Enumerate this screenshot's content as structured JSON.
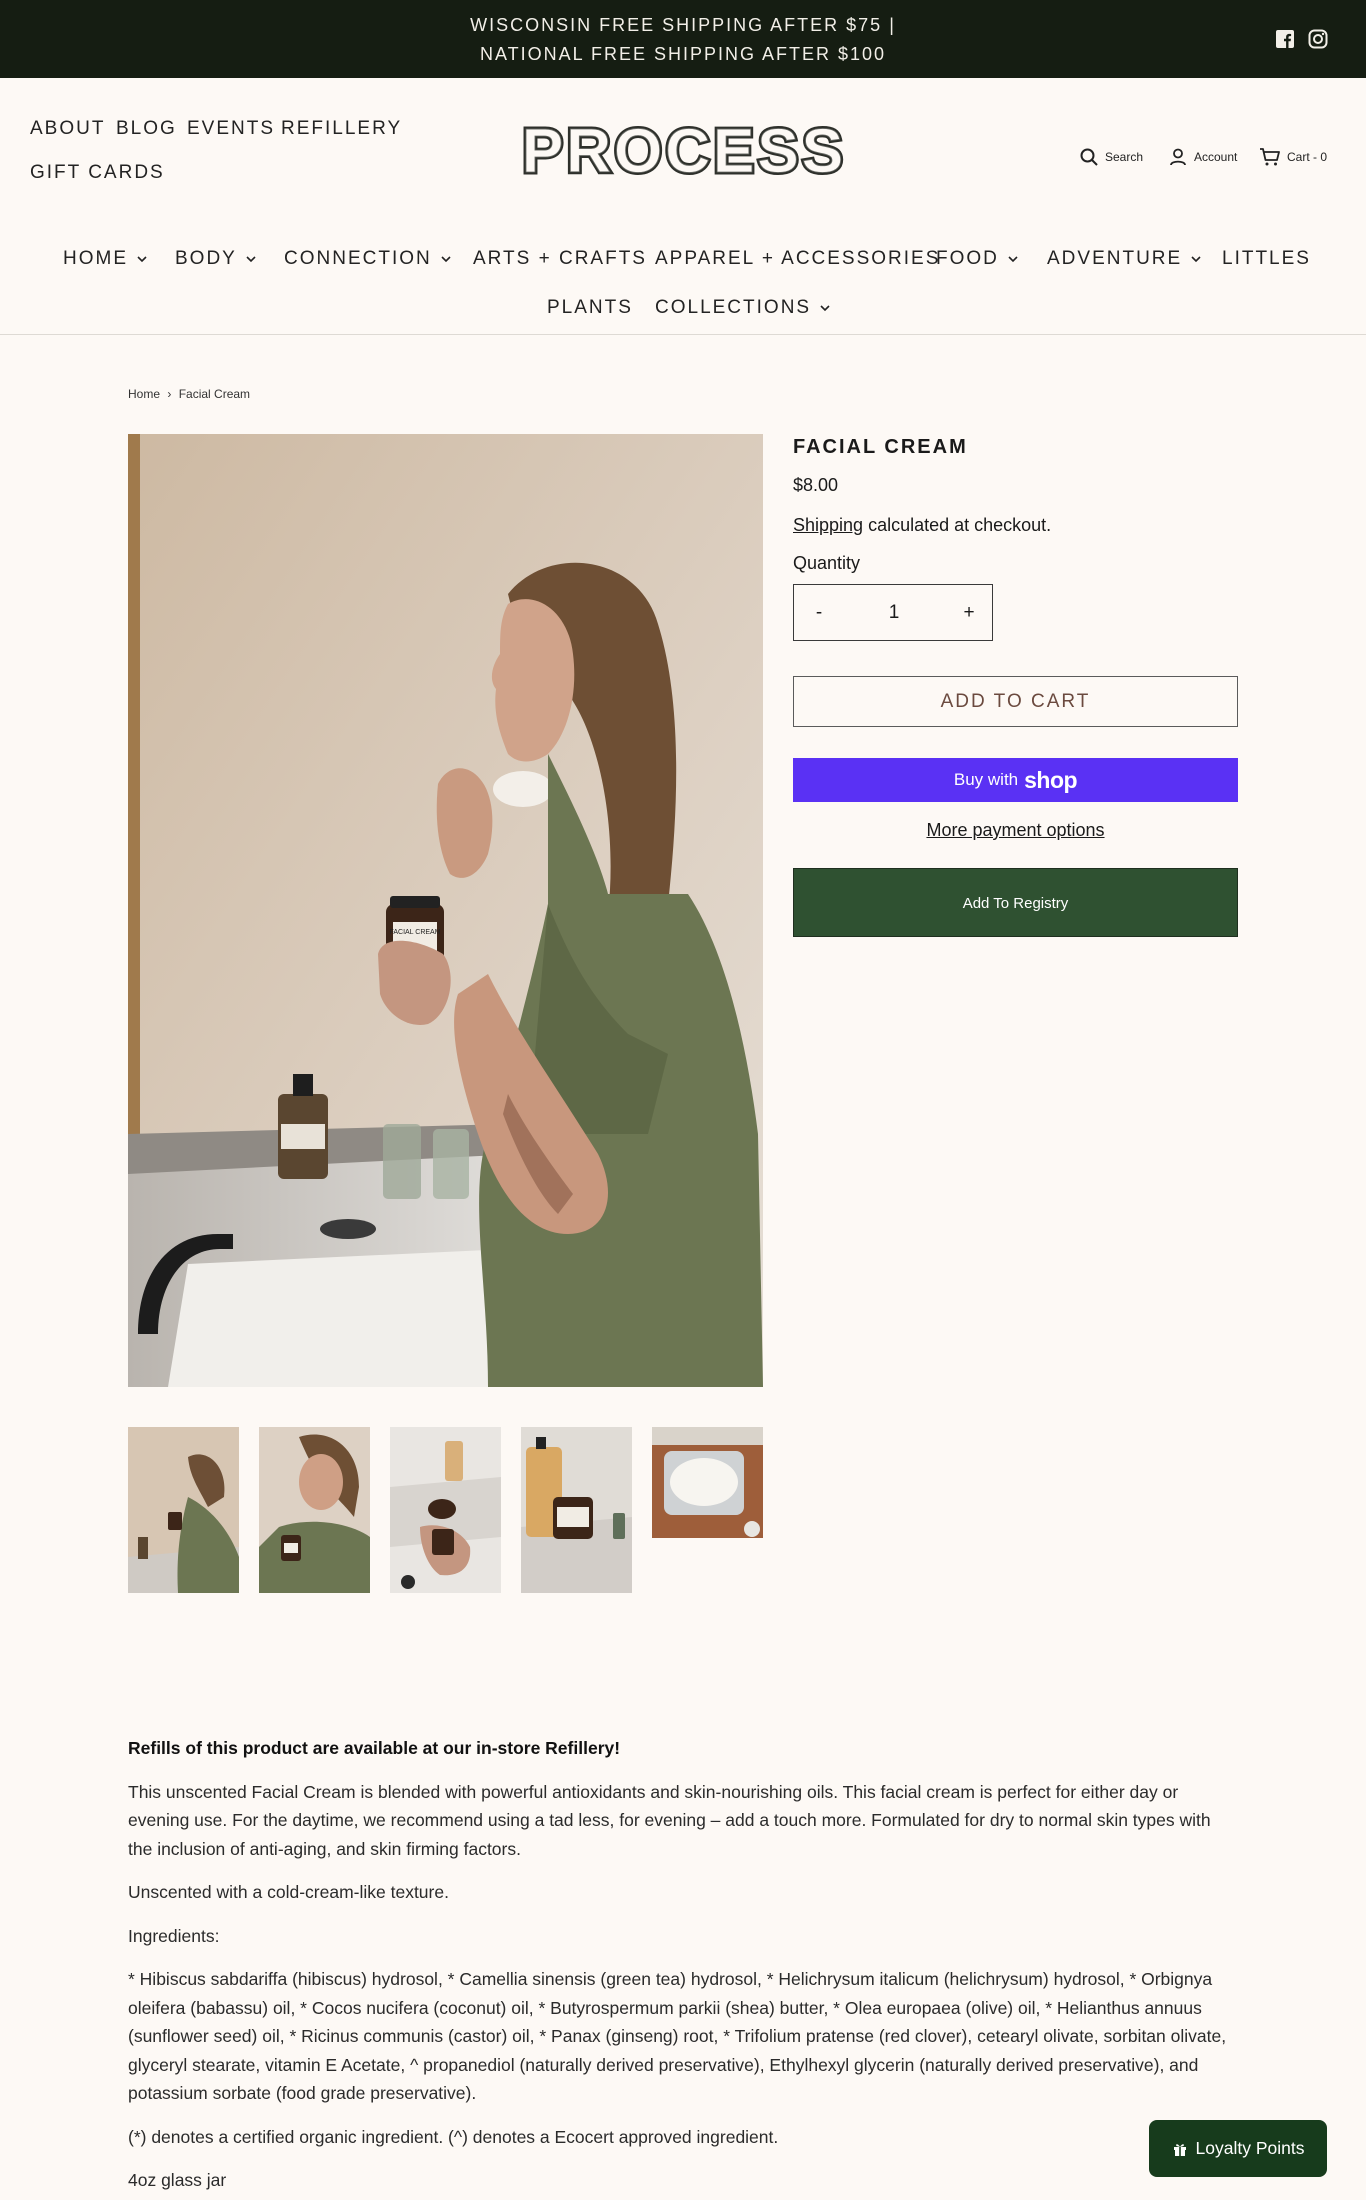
{
  "announcement": {
    "line1": "WISCONSIN FREE SHIPPING AFTER $75 |",
    "line2": "NATIONAL FREE SHIPPING AFTER $100"
  },
  "social": [
    {
      "icon": "facebook-icon"
    },
    {
      "icon": "instagram-icon"
    }
  ],
  "top_links": [
    "ABOUT",
    "BLOG",
    "EVENTS",
    "REFILLERY",
    "GIFT CARDS"
  ],
  "logo": {
    "text": "PROCESS"
  },
  "utility": {
    "search": "Search",
    "account": "Account",
    "cart": "Cart - 0"
  },
  "main_nav": [
    {
      "label": "HOME",
      "dropdown": true
    },
    {
      "label": "BODY",
      "dropdown": true
    },
    {
      "label": "CONNECTION",
      "dropdown": true
    },
    {
      "label": "ARTS + CRAFTS",
      "dropdown": false
    },
    {
      "label": "APPAREL + ACCESSORIES",
      "dropdown": false
    },
    {
      "label": "FOOD",
      "dropdown": true
    },
    {
      "label": "ADVENTURE",
      "dropdown": true
    },
    {
      "label": "LITTLES",
      "dropdown": false
    },
    {
      "label": "PLANTS",
      "dropdown": false
    },
    {
      "label": "COLLECTIONS",
      "dropdown": true
    }
  ],
  "breadcrumb": {
    "home": "Home",
    "separator": "›",
    "current": "Facial Cream"
  },
  "hero_jar_label": "FACIAL CREAM",
  "product": {
    "title": "FACIAL CREAM",
    "price": "$8.00",
    "shipping_link": "Shipping",
    "shipping_rest": " calculated at checkout.",
    "quantity_label": "Quantity",
    "qty_minus": "-",
    "qty_value": "1",
    "qty_plus": "+",
    "add_to_cart": "ADD TO CART",
    "buy_with": "Buy with",
    "shop_word": "shop",
    "more_payment": "More payment options",
    "add_registry": "Add To Registry"
  },
  "description": {
    "refill_note": "Refills of this product are available at our in-store Refillery!",
    "para1": "This unscented Facial Cream is blended with powerful antioxidants and skin-nourishing oils. This facial cream is perfect for either day or evening use. For the daytime, we recommend using a tad less, for evening – add a touch more.  Formulated for dry to normal skin types with the inclusion of anti-aging, and skin firming factors.",
    "para2": "Unscented with a cold-cream-like texture.",
    "para3": "Ingredients:",
    "para4": "* Hibiscus sabdariffa (hibiscus) hydrosol, * Camellia sinensis (green tea) hydrosol, * Helichrysum italicum (helichrysum) hydrosol, * Orbignya oleifera (babassu) oil, * Cocos nucifera (coconut) oil, * Butyrospermum parkii (shea) butter, * Olea europaea (olive) oil, * Helianthus annuus (sunflower seed) oil,  * Ricinus communis (castor) oil, * Panax (ginseng) root, * Trifolium pratense (red clover), cetearyl olivate, sorbitan olivate, glyceryl stearate, vitamin E Acetate, ^ propanediol (naturally derived preservative), Ethylhexyl glycerin (naturally derived preservative), and potassium sorbate (food grade preservative).",
    "para5": "(*) denotes a certified organic ingredient. (^) denotes a Ecocert approved ingredient.",
    "para6": "4oz glass jar"
  },
  "loyalty": {
    "label": "Loyalty Points",
    "icon": "gift-icon"
  },
  "colors": {
    "announcement_bg": "#151d12",
    "page_bg": "#fdf9f5",
    "shop_pay": "#5a31f4",
    "registry_green": "#2f5131",
    "loyalty_green": "#173b1c"
  }
}
